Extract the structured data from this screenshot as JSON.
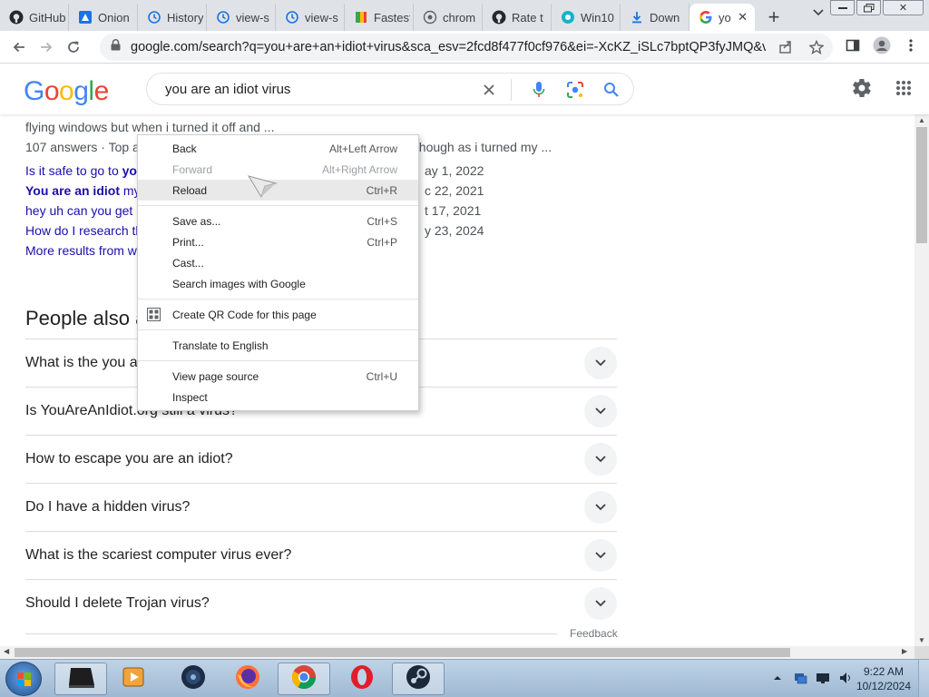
{
  "tabs": [
    {
      "label": "GitHub",
      "icon": "github-icon"
    },
    {
      "label": "Onion",
      "icon": "onion-icon"
    },
    {
      "label": "History",
      "icon": "history-icon"
    },
    {
      "label": "view-s",
      "icon": "history-icon"
    },
    {
      "label": "view-s",
      "icon": "history-icon"
    },
    {
      "label": "Fastest",
      "icon": "bluestacks-icon"
    },
    {
      "label": "chrom",
      "icon": "globe-icon"
    },
    {
      "label": "Rate t",
      "icon": "github-icon"
    },
    {
      "label": "Win10",
      "icon": "app-icon"
    },
    {
      "label": "Down",
      "icon": "download-icon"
    },
    {
      "label": "yo",
      "icon": "google-g-icon",
      "active": true
    }
  ],
  "address_bar": {
    "url": "google.com/search?q=you+are+an+idiot+virus&sca_esv=2fcd8f477f0cf976&ei=-XcKZ_iSLc7bptQP3fyJMQ&ved..."
  },
  "google": {
    "logo": "Google",
    "query": "you are an idiot virus"
  },
  "results": {
    "fragment_1": "flying windows but when i turned it off and ...",
    "fragment_2_left": "107 answers · Top a",
    "fragment_2_right": "s though as i turned my ...",
    "rows": [
      {
        "link_pre": "Is it safe to go to ",
        "link_bold": "yo",
        "link_post": "",
        "date": "ay 1, 2022"
      },
      {
        "link_pre": "",
        "link_bold": "You are an idiot",
        "link_post": " mys",
        "date": "c 22, 2021"
      },
      {
        "link_pre": "hey uh can you get r",
        "link_bold": "",
        "link_post": "",
        "date": "t 17, 2021"
      },
      {
        "link_pre": "How do I research th",
        "link_bold": "",
        "link_post": "",
        "date": "y 23, 2024"
      }
    ],
    "more": "More results from w"
  },
  "people_also_ask": {
    "title": "People also a",
    "questions": [
      "What is the you a",
      "Is YouAreAnIdiot.org still a virus?",
      "How to escape you are an idiot?",
      "Do I have a hidden virus?",
      "What is the scariest computer virus ever?",
      "Should I delete Trojan virus?"
    ],
    "feedback": "Feedback"
  },
  "context_menu": {
    "items": [
      {
        "label": "Back",
        "shortcut": "Alt+Left Arrow"
      },
      {
        "label": "Forward",
        "shortcut": "Alt+Right Arrow",
        "disabled": true
      },
      {
        "label": "Reload",
        "shortcut": "Ctrl+R",
        "highlighted": true
      },
      {
        "label": "Save as...",
        "shortcut": "Ctrl+S"
      },
      {
        "label": "Print...",
        "shortcut": "Ctrl+P"
      },
      {
        "label": "Cast...",
        "shortcut": ""
      },
      {
        "label": "Search images with Google",
        "shortcut": ""
      },
      {
        "label": "Create QR Code for this page",
        "shortcut": "",
        "icon": "qr-code-icon"
      },
      {
        "label": "Translate to English",
        "shortcut": ""
      },
      {
        "label": "View page source",
        "shortcut": "Ctrl+U"
      },
      {
        "label": "Inspect",
        "shortcut": ""
      }
    ]
  },
  "taskbar": {
    "apps": [
      "terminal-icon",
      "media-player-icon",
      "unknown-app-icon",
      "firefox-icon",
      "chrome-icon",
      "opera-icon",
      "steam-icon"
    ],
    "active_app": "chrome-icon",
    "time": "9:22 AM",
    "date": "10/12/2024"
  },
  "colors": {
    "link": "#1a0dab",
    "google_blue": "#4285f4",
    "google_red": "#ea4335",
    "google_yellow": "#fbbc05",
    "google_green": "#34a853"
  }
}
